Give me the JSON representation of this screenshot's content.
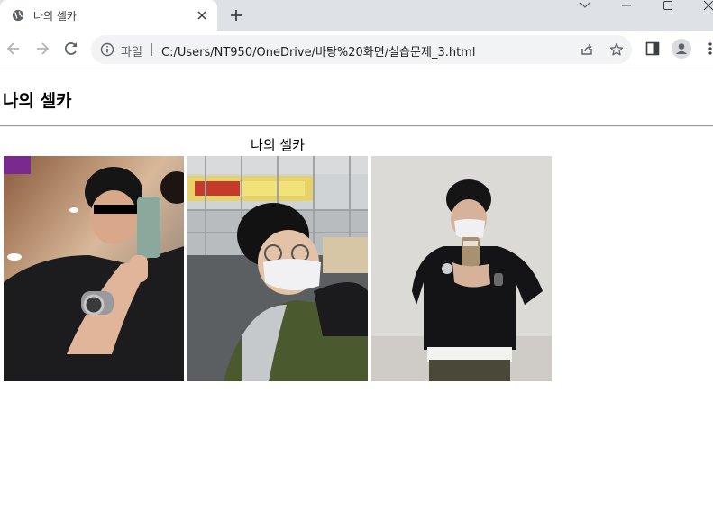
{
  "browser": {
    "tab_title": "나의 셀카",
    "address_scheme_label": "파일",
    "address_url": "C:/Users/NT950/OneDrive/바탕%20화면/실습문제_3.html"
  },
  "page": {
    "heading": "나의 셀카",
    "table_caption": "나의 셀카",
    "photos": [
      {
        "name": "selfie-1"
      },
      {
        "name": "selfie-2"
      },
      {
        "name": "selfie-3"
      }
    ]
  },
  "colors": {
    "tabstrip_bg": "#dee1e6",
    "omnibox_bg": "#f1f3f4",
    "icon_gray": "#5f6368"
  }
}
